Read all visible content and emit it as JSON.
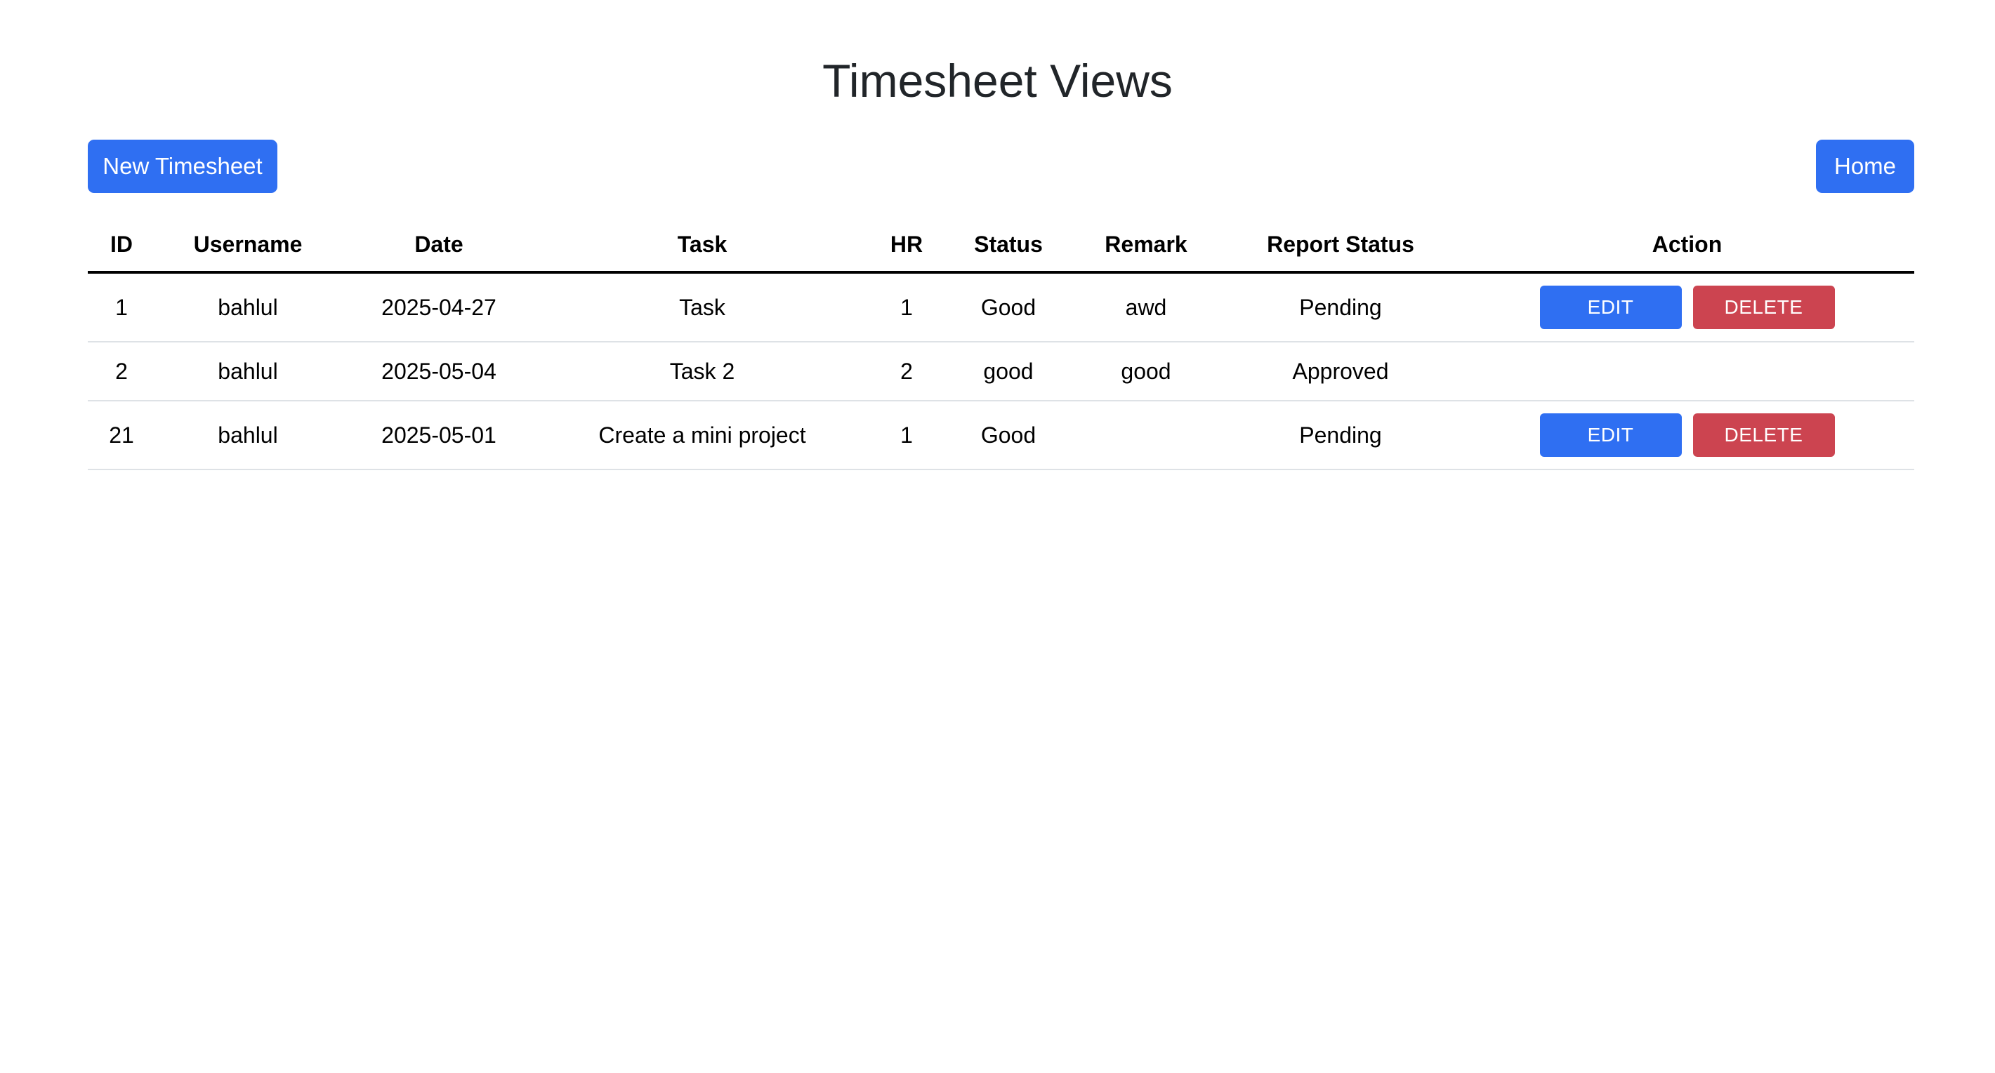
{
  "page": {
    "title": "Timesheet Views"
  },
  "toolbar": {
    "new_label": "New Timesheet",
    "home_label": "Home"
  },
  "table": {
    "columns": [
      "ID",
      "Username",
      "Date",
      "Task",
      "HR",
      "Status",
      "Remark",
      "Report Status",
      "Action"
    ],
    "rows": [
      {
        "id": "1",
        "username": "bahlul",
        "date": "2025-04-27",
        "task": "Task",
        "hr": "1",
        "status": "Good",
        "remark": "awd",
        "report_status": "Pending",
        "edit_label": "EDIT",
        "delete_label": "DELETE"
      },
      {
        "id": "2",
        "username": "bahlul",
        "date": "2025-05-04",
        "task": "Task 2",
        "hr": "2",
        "status": "good",
        "remark": "good",
        "report_status": "Approved"
      },
      {
        "id": "21",
        "username": "bahlul",
        "date": "2025-05-01",
        "task": "Create a mini project",
        "hr": "1",
        "status": "Good",
        "remark": "",
        "report_status": "Pending",
        "edit_label": "EDIT",
        "delete_label": "DELETE"
      }
    ]
  },
  "colors": {
    "primary": "#2f6ff2",
    "danger": "#cc4450",
    "title": "#212529",
    "row_border": "#dee2e6"
  }
}
